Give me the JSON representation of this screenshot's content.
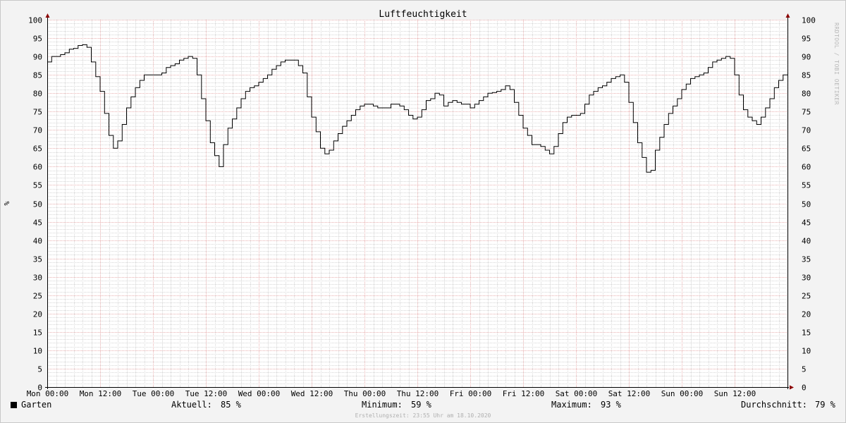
{
  "watermark": "RRDTOOL / TOBI OETIKER",
  "footer": "Erstellungszeit: 23:55 Uhr am 18.10.2020",
  "legend": {
    "series_name": "Garten",
    "current_label": "Aktuell:",
    "current_value": "85 %",
    "min_label": "Minimum:",
    "min_value": "59 %",
    "max_label": "Maximum:",
    "max_value": "93 %",
    "avg_label": "Durchschnitt:",
    "avg_value": "79 %"
  },
  "colors": {
    "background": "#f3f3f3",
    "plot_background": "#ffffff",
    "major_grid": "#e8b0b0",
    "minor_grid": "#d6d6d6",
    "line": "#000000",
    "arrow": "#8b0000"
  },
  "chart_data": {
    "type": "line",
    "title": "Luftfeuchtigkeit",
    "ylabel": "%",
    "xlabel": "",
    "ylim": [
      0,
      100
    ],
    "xlim": [
      0,
      168
    ],
    "x_unit": "hours since Mon 00:00",
    "grid": true,
    "y_ticks": [
      0,
      5,
      10,
      15,
      20,
      25,
      30,
      35,
      40,
      45,
      50,
      55,
      60,
      65,
      70,
      75,
      80,
      85,
      90,
      95,
      100
    ],
    "x_tick_labels": [
      "Mon 00:00",
      "Mon 12:00",
      "Tue 00:00",
      "Tue 12:00",
      "Wed 00:00",
      "Wed 12:00",
      "Thu 00:00",
      "Thu 12:00",
      "Fri 00:00",
      "Fri 12:00",
      "Sat 00:00",
      "Sat 12:00",
      "Sun 00:00",
      "Sun 12:00"
    ],
    "x_tick_positions": [
      0,
      12,
      24,
      36,
      48,
      60,
      72,
      84,
      96,
      108,
      120,
      132,
      144,
      156
    ],
    "series": [
      {
        "name": "Garten",
        "step": true,
        "x": [
          0,
          1,
          2,
          3,
          4,
          5,
          6,
          7,
          8,
          9,
          10,
          11,
          12,
          13,
          14,
          15,
          16,
          17,
          18,
          19,
          20,
          21,
          22,
          23,
          24,
          25,
          26,
          27,
          28,
          29,
          30,
          31,
          32,
          33,
          34,
          35,
          36,
          37,
          38,
          39,
          40,
          41,
          42,
          43,
          44,
          45,
          46,
          47,
          48,
          49,
          50,
          51,
          52,
          53,
          54,
          55,
          56,
          57,
          58,
          59,
          60,
          61,
          62,
          63,
          64,
          65,
          66,
          67,
          68,
          69,
          70,
          71,
          72,
          73,
          74,
          75,
          76,
          77,
          78,
          79,
          80,
          81,
          82,
          83,
          84,
          85,
          86,
          87,
          88,
          89,
          90,
          91,
          92,
          93,
          94,
          95,
          96,
          97,
          98,
          99,
          100,
          101,
          102,
          103,
          104,
          105,
          106,
          107,
          108,
          109,
          110,
          111,
          112,
          113,
          114,
          115,
          116,
          117,
          118,
          119,
          120,
          121,
          122,
          123,
          124,
          125,
          126,
          127,
          128,
          129,
          130,
          131,
          132,
          133,
          134,
          135,
          136,
          137,
          138,
          139,
          140,
          141,
          142,
          143,
          144,
          145,
          146,
          147,
          148,
          149,
          150,
          151,
          152,
          153,
          154,
          155,
          156,
          157,
          158,
          159,
          160,
          161,
          162,
          163,
          164,
          165,
          166,
          167
        ],
        "values": [
          88.5,
          90,
          90,
          90.5,
          91,
          92,
          92.2,
          93,
          93.2,
          92.5,
          88.5,
          84.5,
          80.5,
          74.5,
          68.5,
          65,
          67,
          71.5,
          76,
          79,
          81.5,
          83.5,
          85,
          85,
          85,
          85,
          85.5,
          87,
          87.5,
          88,
          89,
          89.5,
          90,
          89.5,
          85,
          78.5,
          72.5,
          66.5,
          63,
          60,
          66,
          70.5,
          73,
          76,
          78.5,
          80.5,
          81.5,
          82,
          83,
          84,
          85,
          86.5,
          87.5,
          88.5,
          89,
          89,
          89,
          87.5,
          85.5,
          79,
          73.5,
          69.5,
          65,
          63.5,
          64.5,
          67,
          69,
          71,
          72.5,
          74,
          75.5,
          76.5,
          77,
          77,
          76.5,
          76,
          76,
          76,
          77,
          77,
          76.5,
          75.5,
          74,
          73,
          73.5,
          75.5,
          78,
          78.5,
          80,
          79.5,
          76.5,
          77.5,
          78,
          77.5,
          77,
          77,
          76,
          77,
          78,
          79,
          80,
          80.2,
          80.5,
          81,
          82,
          81,
          77.5,
          74,
          70.5,
          68.5,
          66,
          66,
          65.5,
          64.5,
          63.5,
          65.5,
          69,
          72,
          73.5,
          74,
          74,
          74.5,
          77,
          79.5,
          80.5,
          81.5,
          82,
          83,
          84,
          84.5,
          85,
          83,
          77.5,
          72,
          66.5,
          62.5,
          58.5,
          59,
          64.5,
          68,
          71.5,
          74.5,
          76.5,
          78.5,
          81,
          82.5,
          84,
          84.5,
          85,
          85.5,
          87,
          88.5,
          89,
          89.5,
          90,
          89.5,
          85,
          79.5,
          75.5,
          73.5,
          72.5,
          71.5,
          73.5,
          76,
          78.5,
          81.5,
          83.5,
          85
        ]
      }
    ]
  }
}
